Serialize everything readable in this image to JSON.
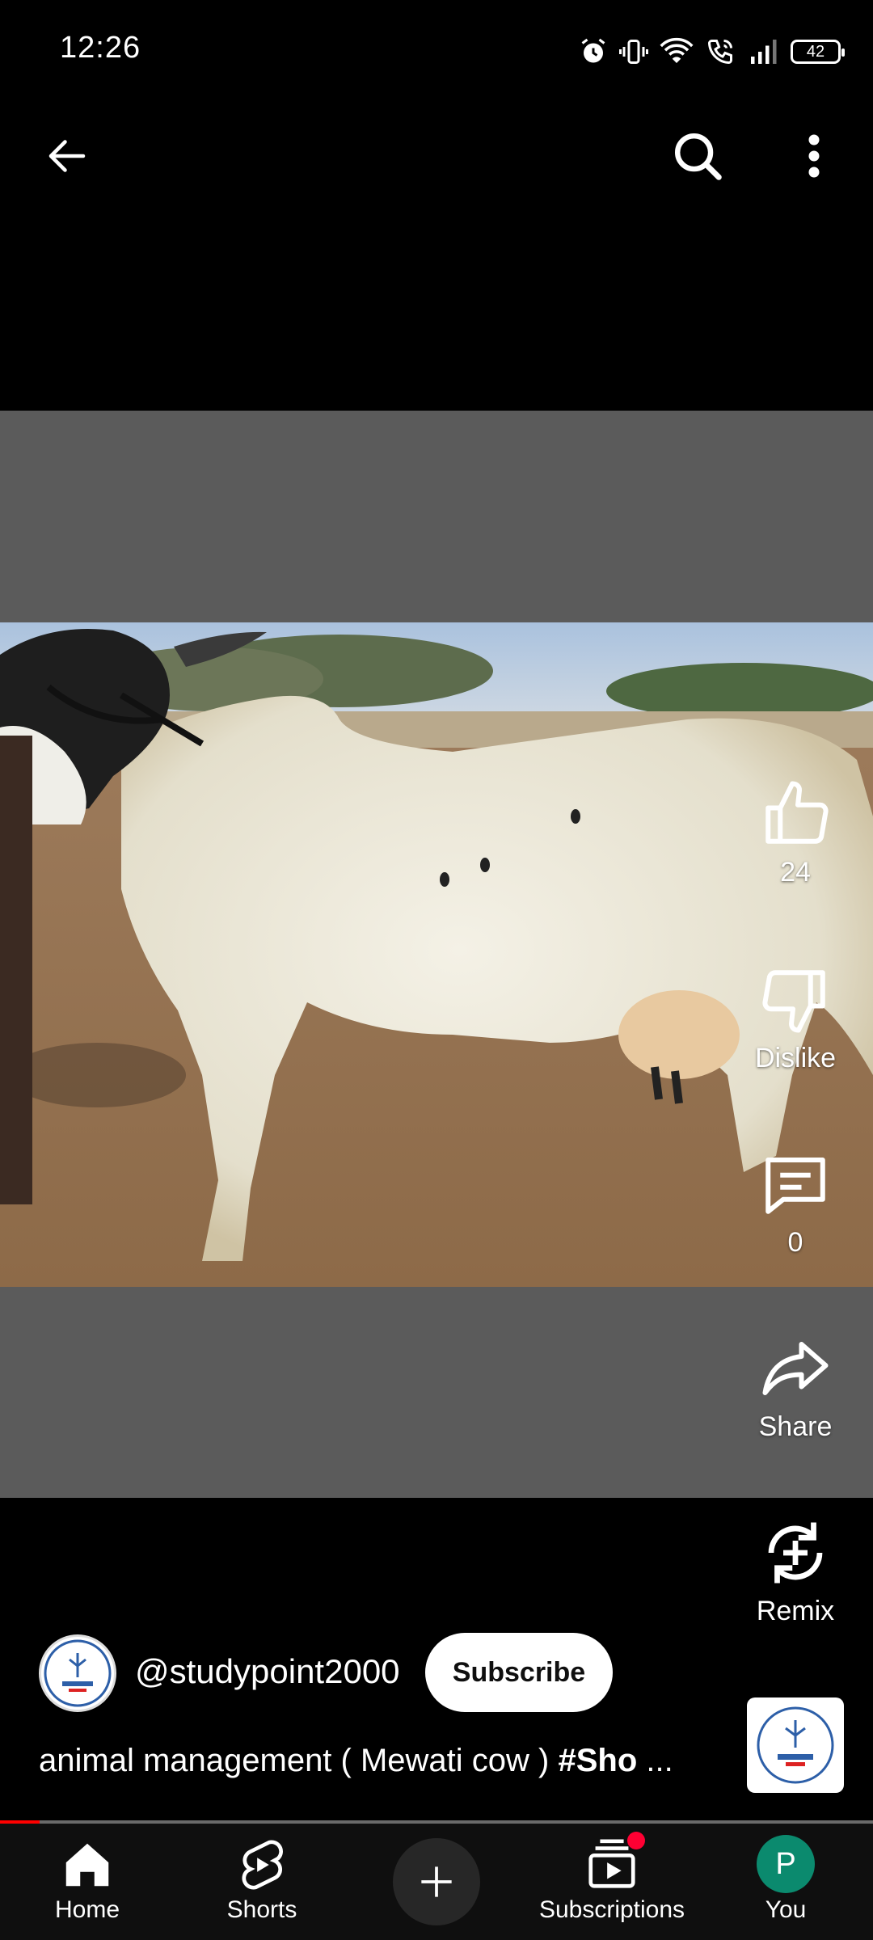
{
  "status_bar": {
    "time": "12:26",
    "battery": "42"
  },
  "colors": {
    "accent": "#ff0000",
    "you_avatar": "#0b8a6e",
    "video_bg": "#5b5b5b"
  },
  "top_bar": {
    "back_icon": "arrow-left-icon",
    "search_icon": "search-icon",
    "more_icon": "more-vertical-icon"
  },
  "actions": {
    "like_count": "24",
    "dislike_label": "Dislike",
    "comment_count": "0",
    "share_label": "Share",
    "remix_label": "Remix"
  },
  "channel": {
    "handle": "@studypoint2000",
    "subscribe_label": "Subscribe"
  },
  "video": {
    "title_text": "animal management ( Mewati cow ) ",
    "title_hashtag": "#Sho",
    "title_ellipsis": " ...",
    "progress_fraction": 0.045
  },
  "nav": {
    "items": [
      {
        "label": "Home",
        "icon": "home-icon"
      },
      {
        "label": "Shorts",
        "icon": "shorts-icon"
      },
      {
        "label": "",
        "icon": "plus-icon"
      },
      {
        "label": "Subscriptions",
        "icon": "subscriptions-icon"
      },
      {
        "label": "You",
        "icon": "avatar"
      }
    ],
    "you_initial": "P"
  }
}
